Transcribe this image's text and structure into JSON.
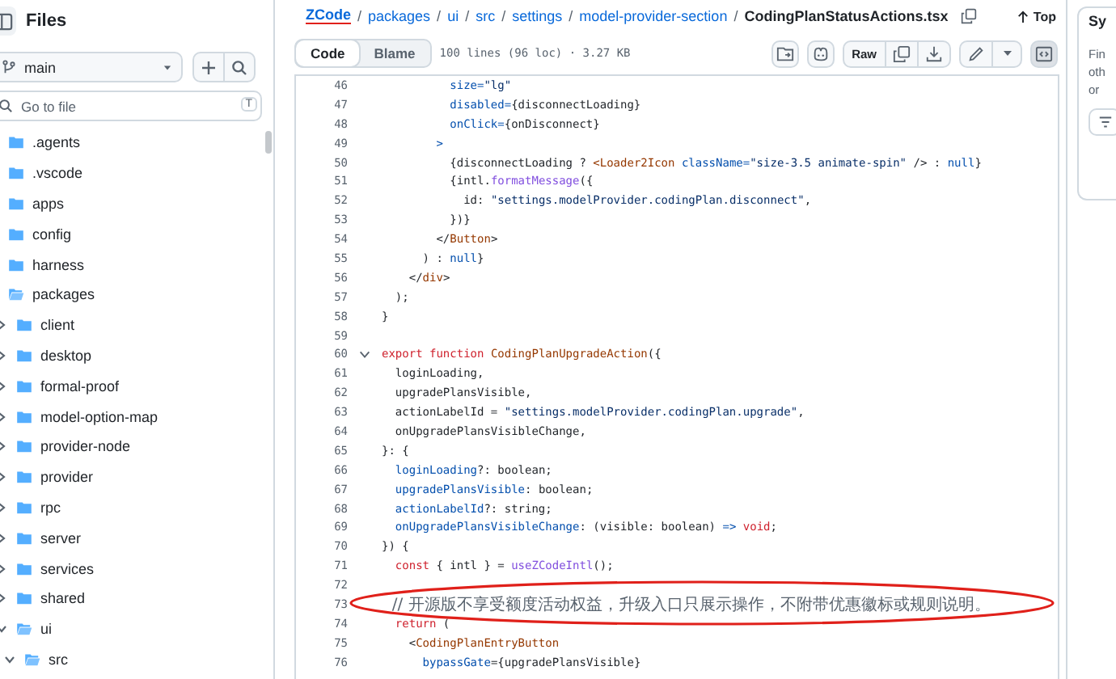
{
  "sidebar": {
    "title": "Files",
    "branch": "main",
    "go_to_file": {
      "placeholder": "Go to file",
      "shortcut": "T"
    },
    "tree": [
      {
        "name": ".agents",
        "expanded": false
      },
      {
        "name": ".vscode",
        "expanded": false
      },
      {
        "name": "apps",
        "expanded": false
      },
      {
        "name": "config",
        "expanded": false
      },
      {
        "name": "harness",
        "expanded": false
      },
      {
        "name": "packages",
        "expanded": true,
        "children": [
          {
            "name": "client",
            "expanded": false
          },
          {
            "name": "desktop",
            "expanded": false
          },
          {
            "name": "formal-proof",
            "expanded": false
          },
          {
            "name": "model-option-map",
            "expanded": false
          },
          {
            "name": "provider-node",
            "expanded": false
          },
          {
            "name": "provider",
            "expanded": false
          },
          {
            "name": "rpc",
            "expanded": false
          },
          {
            "name": "server",
            "expanded": false
          },
          {
            "name": "services",
            "expanded": false
          },
          {
            "name": "shared",
            "expanded": false
          },
          {
            "name": "ui",
            "expanded": true,
            "children": [
              {
                "name": "src",
                "expanded": true
              }
            ]
          }
        ]
      }
    ]
  },
  "breadcrumb": {
    "separator": "/",
    "parts": [
      {
        "label": "ZCode",
        "kind": "repo"
      },
      {
        "label": "packages",
        "kind": "dir"
      },
      {
        "label": "ui",
        "kind": "dir"
      },
      {
        "label": "src",
        "kind": "dir"
      },
      {
        "label": "settings",
        "kind": "dir"
      },
      {
        "label": "model-provider-section",
        "kind": "dir"
      },
      {
        "label": "CodingPlanStatusActions.tsx",
        "kind": "file"
      }
    ],
    "top_label": "Top"
  },
  "toolbar": {
    "tabs": [
      {
        "label": "Code",
        "selected": true
      },
      {
        "label": "Blame",
        "selected": false
      }
    ],
    "file_info": "100 lines (96 loc) · 3.27 KB",
    "raw_label": "Raw",
    "symbols_open": true
  },
  "code": {
    "lines": [
      {
        "num": "46",
        "foldable": false,
        "tokens": [
          {
            "t": "          size=",
            "kind": "prop"
          },
          {
            "t": "\"lg\"",
            "kind": "string"
          }
        ]
      },
      {
        "num": "47",
        "foldable": false,
        "tokens": [
          {
            "t": "          disabled=",
            "kind": "prop"
          },
          {
            "t": "{disconnectLoading}",
            "kind": "plain"
          }
        ]
      },
      {
        "num": "48",
        "foldable": false,
        "tokens": [
          {
            "t": "          onClick=",
            "kind": "prop"
          },
          {
            "t": "{onDisconnect}",
            "kind": "plain"
          }
        ]
      },
      {
        "num": "49",
        "foldable": false,
        "tokens": [
          {
            "t": "        >",
            "kind": "prop"
          }
        ]
      },
      {
        "num": "50",
        "foldable": false,
        "tokens": [
          {
            "t": "          {disconnectLoading ? ",
            "kind": "plain"
          },
          {
            "t": "<Loader2Icon",
            "kind": "tag"
          },
          {
            "t": " className=",
            "kind": "prop"
          },
          {
            "t": "\"size-3.5 animate-spin\"",
            "kind": "string"
          },
          {
            "t": " /> : ",
            "kind": "plain"
          },
          {
            "t": "null",
            "kind": "prop"
          },
          {
            "t": "}",
            "kind": "plain"
          }
        ]
      },
      {
        "num": "51",
        "foldable": false,
        "tokens": [
          {
            "t": "          {intl.",
            "kind": "plain"
          },
          {
            "t": "formatMessage",
            "kind": "function"
          },
          {
            "t": "({",
            "kind": "plain"
          }
        ]
      },
      {
        "num": "52",
        "foldable": false,
        "tokens": [
          {
            "t": "            id: ",
            "kind": "plain"
          },
          {
            "t": "\"settings.modelProvider.codingPlan.disconnect\"",
            "kind": "string"
          },
          {
            "t": ",",
            "kind": "plain"
          }
        ]
      },
      {
        "num": "53",
        "foldable": false,
        "tokens": [
          {
            "t": "          })}",
            "kind": "plain"
          }
        ]
      },
      {
        "num": "54",
        "foldable": false,
        "tokens": [
          {
            "t": "        </",
            "kind": "plain"
          },
          {
            "t": "Button",
            "kind": "tag"
          },
          {
            "t": ">",
            "kind": "plain"
          }
        ]
      },
      {
        "num": "55",
        "foldable": false,
        "tokens": [
          {
            "t": "      ) : ",
            "kind": "plain"
          },
          {
            "t": "null",
            "kind": "prop"
          },
          {
            "t": "}",
            "kind": "plain"
          }
        ]
      },
      {
        "num": "56",
        "foldable": false,
        "tokens": [
          {
            "t": "    </",
            "kind": "plain"
          },
          {
            "t": "div",
            "kind": "tag"
          },
          {
            "t": ">",
            "kind": "plain"
          }
        ]
      },
      {
        "num": "57",
        "foldable": false,
        "tokens": [
          {
            "t": "  );",
            "kind": "plain"
          }
        ]
      },
      {
        "num": "58",
        "foldable": false,
        "tokens": [
          {
            "t": "}",
            "kind": "plain"
          }
        ]
      },
      {
        "num": "59",
        "foldable": false
      },
      {
        "num": "60",
        "foldable": true,
        "tokens": [
          {
            "t": "export function ",
            "kind": "keyword"
          },
          {
            "t": "CodingPlanUpgradeAction",
            "kind": "tag"
          },
          {
            "t": "({",
            "kind": "plain"
          }
        ]
      },
      {
        "num": "61",
        "foldable": false,
        "tokens": [
          {
            "t": "  loginLoading,",
            "kind": "plain"
          }
        ]
      },
      {
        "num": "62",
        "foldable": false,
        "tokens": [
          {
            "t": "  upgradePlansVisible,",
            "kind": "plain"
          }
        ]
      },
      {
        "num": "63",
        "foldable": false,
        "tokens": [
          {
            "t": "  actionLabelId = ",
            "kind": "plain"
          },
          {
            "t": "\"settings.modelProvider.codingPlan.upgrade\"",
            "kind": "string"
          },
          {
            "t": ",",
            "kind": "plain"
          }
        ]
      },
      {
        "num": "64",
        "foldable": false,
        "tokens": [
          {
            "t": "  onUpgradePlansVisibleChange,",
            "kind": "plain"
          }
        ]
      },
      {
        "num": "65",
        "foldable": false,
        "tokens": [
          {
            "t": "}: {",
            "kind": "plain"
          }
        ]
      },
      {
        "num": "66",
        "foldable": false,
        "tokens": [
          {
            "t": "  loginLoading",
            "kind": "prop"
          },
          {
            "t": "?: boolean;",
            "kind": "plain"
          }
        ]
      },
      {
        "num": "67",
        "foldable": false,
        "tokens": [
          {
            "t": "  upgradePlansVisible",
            "kind": "prop"
          },
          {
            "t": ": boolean;",
            "kind": "plain"
          }
        ]
      },
      {
        "num": "68",
        "foldable": false,
        "tokens": [
          {
            "t": "  actionLabelId",
            "kind": "prop"
          },
          {
            "t": "?: string;",
            "kind": "plain"
          }
        ]
      },
      {
        "num": "69",
        "foldable": false,
        "tokens": [
          {
            "t": "  onUpgradePlansVisibleChange",
            "kind": "prop"
          },
          {
            "t": ": (visible: boolean) ",
            "kind": "plain"
          },
          {
            "t": "=> ",
            "kind": "prop"
          },
          {
            "t": "void",
            "kind": "keyword"
          },
          {
            "t": ";",
            "kind": "plain"
          }
        ]
      },
      {
        "num": "70",
        "foldable": false,
        "tokens": [
          {
            "t": "}) {",
            "kind": "plain"
          }
        ]
      },
      {
        "num": "71",
        "foldable": false,
        "tokens": [
          {
            "t": "  const",
            "kind": "keyword"
          },
          {
            "t": " { intl } = ",
            "kind": "plain"
          },
          {
            "t": "useZCodeIntl",
            "kind": "function"
          },
          {
            "t": "();",
            "kind": "plain"
          }
        ]
      },
      {
        "num": "72",
        "foldable": false
      },
      {
        "num": "73",
        "foldable": false,
        "tokens": [
          {
            "t": "  // 开源版不享受额度活动权益，升级入口只展示操作，不附带优惠徽标或规则说明。",
            "kind": "comment"
          }
        ]
      },
      {
        "num": "74",
        "foldable": false,
        "tokens": [
          {
            "t": "  return",
            "kind": "keyword"
          },
          {
            "t": " (",
            "kind": "plain"
          }
        ]
      },
      {
        "num": "75",
        "foldable": false,
        "tokens": [
          {
            "t": "    <",
            "kind": "plain"
          },
          {
            "t": "CodingPlanEntryButton",
            "kind": "tag"
          }
        ]
      },
      {
        "num": "76",
        "foldable": false,
        "tokens": [
          {
            "t": "      bypassGate",
            "kind": "prop"
          },
          {
            "t": "={upgradePlansVisible}",
            "kind": "plain"
          }
        ]
      }
    ]
  },
  "symbols_panel": {
    "title": "Sy",
    "text_lines": [
      "Fin",
      "oth",
      "or"
    ]
  }
}
